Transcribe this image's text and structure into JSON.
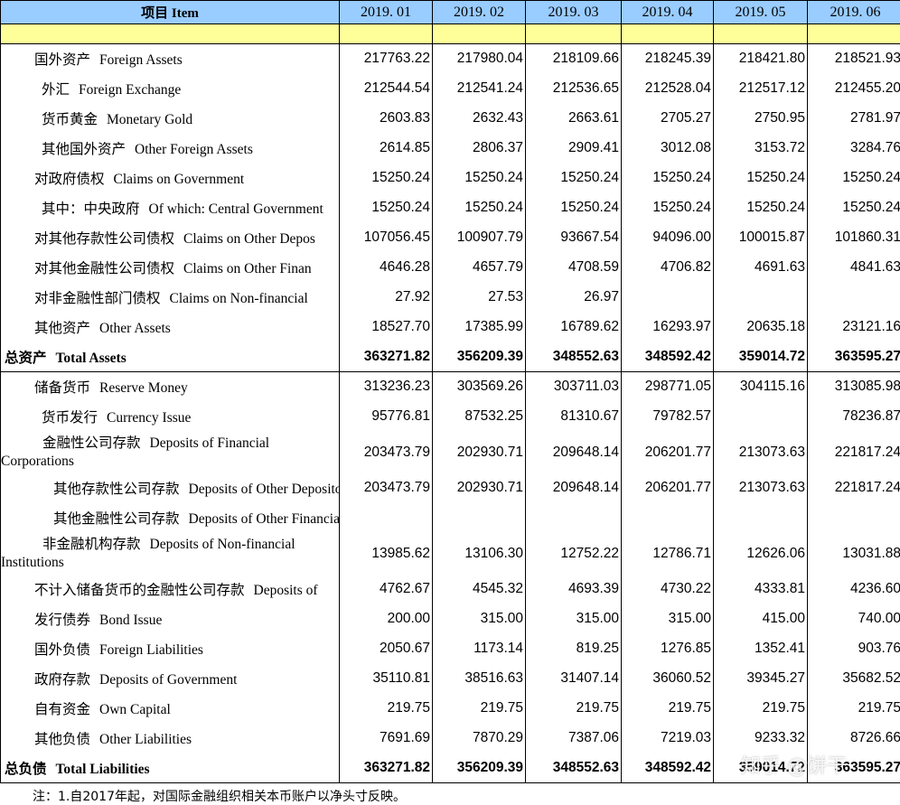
{
  "header": {
    "item": "项目 Item",
    "months": [
      "2019. 01",
      "2019. 02",
      "2019. 03",
      "2019. 04",
      "2019. 05",
      "2019. 06"
    ]
  },
  "rows": [
    {
      "zh": "国外资产",
      "en": "Foreign Assets",
      "values": [
        "217763.22",
        "217980.04",
        "218109.66",
        "218245.39",
        "218421.80",
        "218521.93"
      ]
    },
    {
      "zh": "外汇",
      "en": "Foreign Exchange",
      "values": [
        "212544.54",
        "212541.24",
        "212536.65",
        "212528.04",
        "212517.12",
        "212455.20"
      ]
    },
    {
      "zh": "货币黄金",
      "en": "Monetary Gold",
      "values": [
        "2603.83",
        "2632.43",
        "2663.61",
        "2705.27",
        "2750.95",
        "2781.97"
      ]
    },
    {
      "zh": "其他国外资产",
      "en": "Other Foreign Assets",
      "values": [
        "2614.85",
        "2806.37",
        "2909.41",
        "3012.08",
        "3153.72",
        "3284.76"
      ]
    },
    {
      "zh": "对政府债权",
      "en": "Claims on Government",
      "values": [
        "15250.24",
        "15250.24",
        "15250.24",
        "15250.24",
        "15250.24",
        "15250.24"
      ]
    },
    {
      "zh": "其中：中央政府",
      "en": "Of which: Central Government",
      "values": [
        "15250.24",
        "15250.24",
        "15250.24",
        "15250.24",
        "15250.24",
        "15250.24"
      ]
    },
    {
      "zh": "对其他存款性公司债权",
      "en": "Claims on Other Depos",
      "values": [
        "107056.45",
        "100907.79",
        "93667.54",
        "94096.00",
        "100015.87",
        "101860.31"
      ]
    },
    {
      "zh": "对其他金融性公司债权",
      "en": "Claims on Other Finan",
      "values": [
        "4646.28",
        "4657.79",
        "4708.59",
        "4706.82",
        "4691.63",
        "4841.63"
      ]
    },
    {
      "zh": "对非金融性部门债权",
      "en": "Claims on Non-financial",
      "values": [
        "27.92",
        "27.53",
        "26.97",
        "",
        "",
        ""
      ]
    },
    {
      "zh": "其他资产",
      "en": "Other Assets",
      "values": [
        "18527.70",
        "17385.99",
        "16789.62",
        "16293.97",
        "20635.18",
        "23121.16"
      ]
    },
    {
      "zh": "总资产",
      "en": "Total Assets",
      "values": [
        "363271.82",
        "356209.39",
        "348552.63",
        "348592.42",
        "359014.72",
        "363595.27"
      ]
    },
    {
      "zh": "储备货币",
      "en": "Reserve Money",
      "values": [
        "313236.23",
        "303569.26",
        "303711.03",
        "298771.05",
        "304115.16",
        "313085.98"
      ]
    },
    {
      "zh": "货币发行",
      "en": "Currency Issue",
      "values": [
        "95776.81",
        "87532.25",
        "81310.67",
        "79782.57",
        "",
        "78236.87"
      ]
    },
    {
      "zh": "金融性公司存款",
      "en": "Deposits of  Financial",
      "en2": "Corporations",
      "values": [
        "203473.79",
        "202930.71",
        "209648.14",
        "206201.77",
        "213073.63",
        "221817.24"
      ]
    },
    {
      "zh": "其他存款性公司存款",
      "en": "Deposits of  Other Depository",
      "values": [
        "203473.79",
        "202930.71",
        "209648.14",
        "206201.77",
        "213073.63",
        "221817.24"
      ]
    },
    {
      "zh": "其他金融性公司存款",
      "en": "Deposits of  Other Financial",
      "values": [
        "",
        "",
        "",
        "",
        "",
        ""
      ]
    },
    {
      "zh": "非金融机构存款",
      "en": "Deposits of  Non-financial",
      "en2": "Institutions",
      "values": [
        "13985.62",
        "13106.30",
        "12752.22",
        "12786.71",
        "12626.06",
        "13031.88"
      ]
    },
    {
      "zh": "不计入储备货币的金融性公司存款",
      "en": "Deposits of",
      "values": [
        "4762.67",
        "4545.32",
        "4693.39",
        "4730.22",
        "4333.81",
        "4236.60"
      ]
    },
    {
      "zh": "发行债券",
      "en": "Bond Issue",
      "values": [
        "200.00",
        "315.00",
        "315.00",
        "315.00",
        "415.00",
        "740.00"
      ]
    },
    {
      "zh": "国外负债",
      "en": "Foreign Liabilities",
      "values": [
        "2050.67",
        "1173.14",
        "819.25",
        "1276.85",
        "1352.41",
        "903.76"
      ]
    },
    {
      "zh": "政府存款",
      "en": "Deposits of Government",
      "values": [
        "35110.81",
        "38516.63",
        "31407.14",
        "36060.52",
        "39345.27",
        "35682.52"
      ]
    },
    {
      "zh": "自有资金",
      "en": "Own Capital",
      "values": [
        "219.75",
        "219.75",
        "219.75",
        "219.75",
        "219.75",
        "219.75"
      ]
    },
    {
      "zh": "其他负债",
      "en": "Other Liabilities",
      "values": [
        "7691.69",
        "7870.29",
        "7387.06",
        "7219.03",
        "9233.32",
        "8726.66"
      ]
    },
    {
      "zh": "总负债",
      "en": "Total  Liabilities",
      "values": [
        "363271.82",
        "356209.39",
        "348552.63",
        "348592.42",
        "359014.72",
        "363595.27"
      ]
    }
  ],
  "note": "注：1.自2017年起，对国际金融组织相关本币账户以净头寸反映。",
  "watermark": "知乎 @饼干"
}
